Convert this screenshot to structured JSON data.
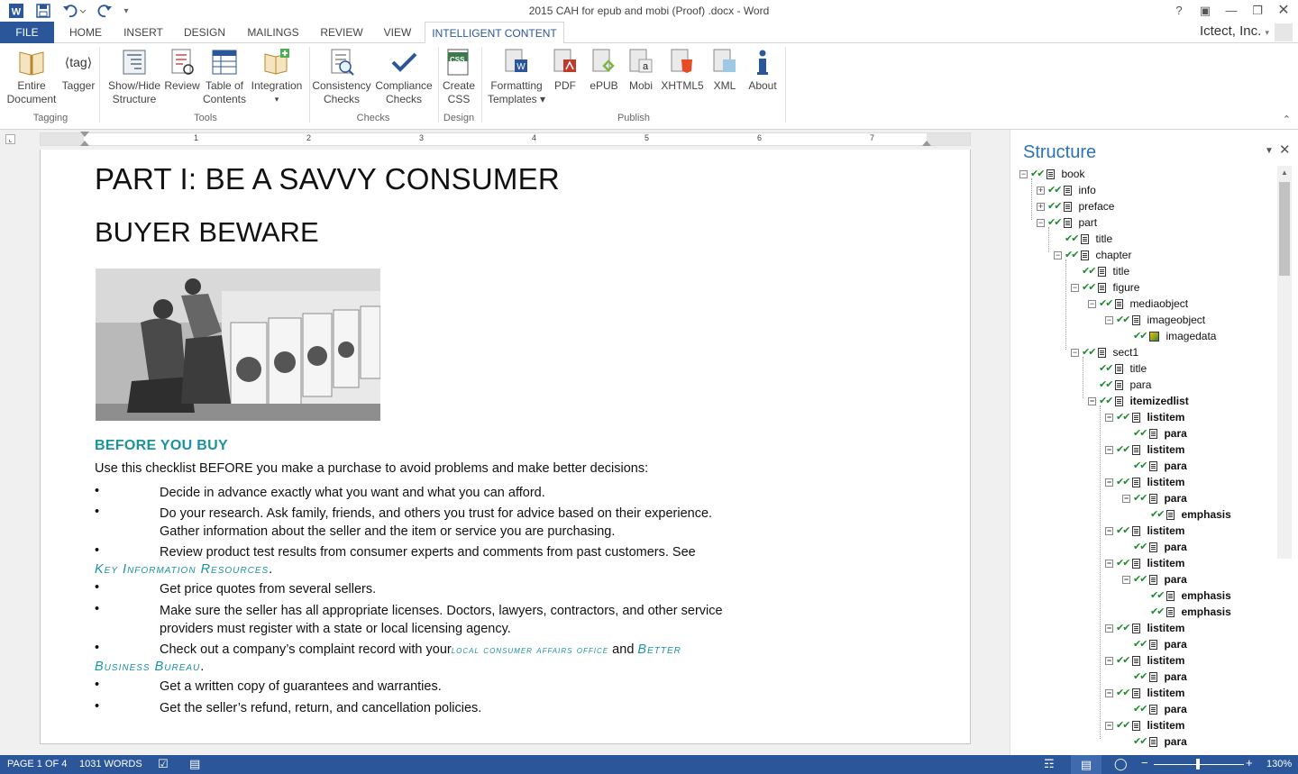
{
  "window": {
    "title": "2015 CAH for epub and mobi (Proof) .docx - Word",
    "help": "?",
    "account": "Ictect, Inc."
  },
  "tabs": [
    "FILE",
    "HOME",
    "INSERT",
    "DESIGN",
    "MAILINGS",
    "REVIEW",
    "VIEW",
    "INTELLIGENT CONTENT"
  ],
  "ribbon": {
    "buttons": [
      {
        "label1": "Entire",
        "label2": "Document"
      },
      {
        "label1": "Tagger",
        "label2": ""
      },
      {
        "label1": "Show/Hide",
        "label2": "Structure"
      },
      {
        "label1": "Review",
        "label2": ""
      },
      {
        "label1": "Table of",
        "label2": "Contents"
      },
      {
        "label1": "Integration",
        "label2": "▾"
      },
      {
        "label1": "Consistency",
        "label2": "Checks"
      },
      {
        "label1": "Compliance",
        "label2": "Checks"
      },
      {
        "label1": "Create",
        "label2": "CSS"
      },
      {
        "label1": "Formatting",
        "label2": "Templates ▾"
      },
      {
        "label1": "PDF",
        "label2": ""
      },
      {
        "label1": "ePUB",
        "label2": ""
      },
      {
        "label1": "Mobi",
        "label2": ""
      },
      {
        "label1": "XHTML5",
        "label2": ""
      },
      {
        "label1": "XML",
        "label2": ""
      },
      {
        "label1": "About",
        "label2": ""
      }
    ],
    "groups": [
      "Tagging",
      "Tools",
      "Checks",
      "Design",
      "Publish"
    ],
    "tagger_icon_text": "⟨tag⟩",
    "css_icon_text": "CSS"
  },
  "ruler": {
    "numbers": [
      "1",
      "2",
      "3",
      "4",
      "5",
      "6",
      "7"
    ]
  },
  "document": {
    "heading1": "PART I: BE A SAVVY CONSUMER",
    "heading2": "BUYER BEWARE",
    "section": "BEFORE YOU BUY",
    "intro": "Use this checklist BEFORE you make a purchase to avoid  problems and make better decisions:",
    "bullet_char": "•",
    "b1": "Decide in advance exactly what you want and what you can afford.",
    "b2a": "Do your research. Ask family, friends, and others you  trust for advice based on their experience.",
    "b2b": "Gather  information about the seller and the item or service you  are  purchasing.",
    "b3a": "Review product test results from consumer experts and  comments from past customers. See",
    "b3link": "Key Information  Resources",
    "b3end": ".",
    "b4": "Get price quotes from several sellers.",
    "b5a": "Make sure the seller has all appropriate licenses. Doctors,  lawyers, contractors, and other service",
    "b5b": "providers must  register with a state or local licensing agency.",
    "b6a": "Check out a company’s complaint record with your",
    "b6link1": "local  consumer  affairs  office",
    "b6and": " and ",
    "b6link2": "Better",
    "b6link3": "Business  Bureau",
    "b6end": ".",
    "b7": "Get a written copy of guarantees and warranties.",
    "b8": "Get the seller’s refund, return, and cancellation policies."
  },
  "structure": {
    "title": "Structure",
    "nodes": [
      {
        "label": "book",
        "depth": 0,
        "exp": "−",
        "icon": "doc",
        "bold": false
      },
      {
        "label": "info",
        "depth": 1,
        "exp": "+",
        "icon": "doc",
        "bold": false
      },
      {
        "label": "preface",
        "depth": 1,
        "exp": "+",
        "icon": "doc",
        "bold": false
      },
      {
        "label": "part",
        "depth": 1,
        "exp": "−",
        "icon": "doc",
        "bold": false
      },
      {
        "label": "title",
        "depth": 2,
        "exp": "",
        "icon": "doc",
        "bold": false
      },
      {
        "label": "chapter",
        "depth": 2,
        "exp": "−",
        "icon": "doc",
        "bold": false
      },
      {
        "label": "title",
        "depth": 3,
        "exp": "",
        "icon": "doc",
        "bold": false
      },
      {
        "label": "figure",
        "depth": 3,
        "exp": "−",
        "icon": "doc",
        "bold": false
      },
      {
        "label": "mediaobject",
        "depth": 4,
        "exp": "−",
        "icon": "doc",
        "bold": false
      },
      {
        "label": "imageobject",
        "depth": 5,
        "exp": "−",
        "icon": "doc",
        "bold": false
      },
      {
        "label": "imagedata",
        "depth": 6,
        "exp": "",
        "icon": "img",
        "bold": false
      },
      {
        "label": "sect1",
        "depth": 3,
        "exp": "−",
        "icon": "doc",
        "bold": false
      },
      {
        "label": "title",
        "depth": 4,
        "exp": "",
        "icon": "doc",
        "bold": false
      },
      {
        "label": "para",
        "depth": 4,
        "exp": "",
        "icon": "doc",
        "bold": false
      },
      {
        "label": "itemizedlist",
        "depth": 4,
        "exp": "−",
        "icon": "doc",
        "bold": true
      },
      {
        "label": "listitem",
        "depth": 5,
        "exp": "−",
        "icon": "doc",
        "bold": true
      },
      {
        "label": "para",
        "depth": 6,
        "exp": "",
        "icon": "doc",
        "bold": true
      },
      {
        "label": "listitem",
        "depth": 5,
        "exp": "−",
        "icon": "doc",
        "bold": true
      },
      {
        "label": "para",
        "depth": 6,
        "exp": "",
        "icon": "doc",
        "bold": true
      },
      {
        "label": "listitem",
        "depth": 5,
        "exp": "−",
        "icon": "doc",
        "bold": true
      },
      {
        "label": "para",
        "depth": 6,
        "exp": "−",
        "icon": "doc",
        "bold": true
      },
      {
        "label": "emphasis",
        "depth": 7,
        "exp": "",
        "icon": "doc",
        "bold": true
      },
      {
        "label": "listitem",
        "depth": 5,
        "exp": "−",
        "icon": "doc",
        "bold": true
      },
      {
        "label": "para",
        "depth": 6,
        "exp": "",
        "icon": "doc",
        "bold": true
      },
      {
        "label": "listitem",
        "depth": 5,
        "exp": "−",
        "icon": "doc",
        "bold": true
      },
      {
        "label": "para",
        "depth": 6,
        "exp": "−",
        "icon": "doc",
        "bold": true
      },
      {
        "label": "emphasis",
        "depth": 7,
        "exp": "",
        "icon": "doc",
        "bold": true
      },
      {
        "label": "emphasis",
        "depth": 7,
        "exp": "",
        "icon": "doc",
        "bold": true
      },
      {
        "label": "listitem",
        "depth": 5,
        "exp": "−",
        "icon": "doc",
        "bold": true
      },
      {
        "label": "para",
        "depth": 6,
        "exp": "",
        "icon": "doc",
        "bold": true
      },
      {
        "label": "listitem",
        "depth": 5,
        "exp": "−",
        "icon": "doc",
        "bold": true
      },
      {
        "label": "para",
        "depth": 6,
        "exp": "",
        "icon": "doc",
        "bold": true
      },
      {
        "label": "listitem",
        "depth": 5,
        "exp": "−",
        "icon": "doc",
        "bold": true
      },
      {
        "label": "para",
        "depth": 6,
        "exp": "",
        "icon": "doc",
        "bold": true
      },
      {
        "label": "listitem",
        "depth": 5,
        "exp": "−",
        "icon": "doc",
        "bold": true
      },
      {
        "label": "para",
        "depth": 6,
        "exp": "",
        "icon": "doc",
        "bold": true
      }
    ]
  },
  "status": {
    "page": "PAGE 1 OF 4",
    "words": "1031 WORDS",
    "zoom": "130%"
  },
  "colors": {
    "brand": "#2b579a",
    "accent": "#1a93a0",
    "check": "#1e8a2e"
  }
}
